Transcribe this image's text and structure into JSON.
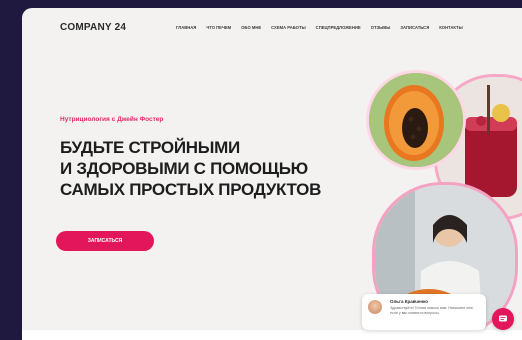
{
  "header": {
    "logo": "COMPANY 24",
    "nav": [
      "ГЛАВНАЯ",
      "ЧТО ПЕЧЕМ",
      "ОБО МНЕ",
      "СХЕМА РАБОТЫ",
      "СПЕЦПРЕДЛОЖЕНИЕ",
      "ОТЗЫВЫ",
      "ЗАПИСАТЬСЯ",
      "КОНТАКТЫ"
    ]
  },
  "hero": {
    "subtitle": "Нутрициология с Джейн Фостер",
    "headline": [
      "БУДЬТЕ СТРОЙНЫМИ",
      "И ЗДОРОВЫМИ С ПОМОЩЬЮ",
      "САМЫХ ПРОСТЫХ ПРОДУКТОВ"
    ],
    "cta_label": "ЗАПИСАТЬСЯ"
  },
  "chat": {
    "name": "Ольга Кравченко",
    "message": "Здравствуйте! Готова помочь вам. Напишите мне, если у вас появятся вопросы."
  },
  "colors": {
    "accent": "#e3165b",
    "background": "#f3f2f1",
    "outer": "#1f1940"
  },
  "icons": {
    "chat_button": "chat-bubble-icon",
    "close": "close-icon"
  }
}
